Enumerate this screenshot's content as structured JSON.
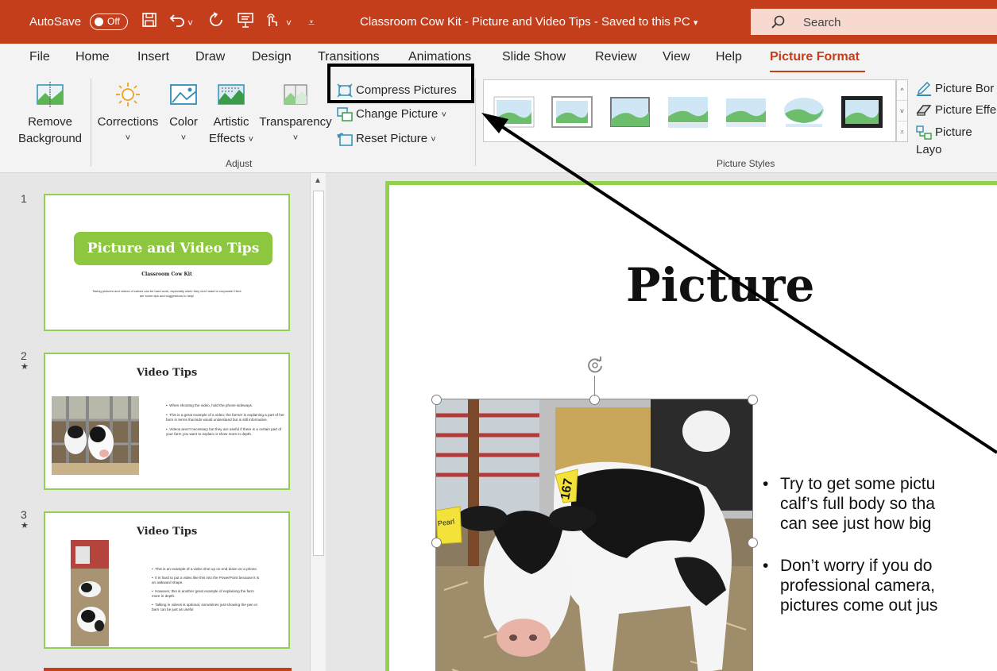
{
  "titlebar": {
    "autosave_label": "AutoSave",
    "autosave_toggle": "Off",
    "document_title": "Classroom Cow Kit - Picture and Video Tips  -  Saved to this PC",
    "search_placeholder": "Search"
  },
  "tabs": [
    "File",
    "Home",
    "Insert",
    "Draw",
    "Design",
    "Transitions",
    "Animations",
    "Slide Show",
    "Review",
    "View",
    "Help",
    "Picture Format"
  ],
  "ribbon": {
    "remove_background": [
      "Remove",
      "Background"
    ],
    "corrections": "Corrections",
    "color": "Color",
    "artistic_effects": [
      "Artistic",
      "Effects"
    ],
    "transparency": "Transparency",
    "compress_pictures": "Compress Pictures",
    "change_picture": "Change Picture",
    "reset_picture": "Reset Picture",
    "adjust_label": "Adjust",
    "picture_styles_label": "Picture Styles",
    "picture_border": "Picture Bor",
    "picture_effects": "Picture Effe",
    "picture_layout": "Picture Layo"
  },
  "slides": [
    {
      "number": "1",
      "title": "Picture and Video Tips",
      "subtitle": "Classroom Cow Kit",
      "body": "Taking pictures and videos of calves can be hard work, especially when they don't want to corporate! Here are some tips and suggestions to help!"
    },
    {
      "number": "2",
      "title": "Video Tips",
      "bullets": [
        "When shooting the video, hold the phone sideways.",
        "This is a great example of a video; the farmer is explaining a part of her farm in terms that kids would understand but is still informative.",
        "Videos aren't necessary but they are useful if there is a certain part of your farm you want to explain or show more in depth."
      ]
    },
    {
      "number": "3",
      "title": "Video Tips",
      "bullets": [
        "This is an example of a video shot up on end down on a phone.",
        "It is hard to put a video like this into the PowerPoint because it is an awkward shape.",
        "However, this is another great example of explaining the farm more in depth.",
        "Talking in videos is optional, sometimes just showing the pen or barn can be just as useful"
      ]
    }
  ],
  "main_slide": {
    "title": "Picture",
    "bullets": [
      [
        "Try to get some pictu",
        "calf’s full body so tha",
        "can see just how big"
      ],
      [
        "Don’t worry if you do",
        "professional camera,",
        "pictures come out jus"
      ]
    ],
    "tag_text": "167",
    "tag_name": "Pearl"
  },
  "colors": {
    "accent": "#c43e1c",
    "slide_border": "#92d050",
    "title_green": "#8dc63f"
  }
}
